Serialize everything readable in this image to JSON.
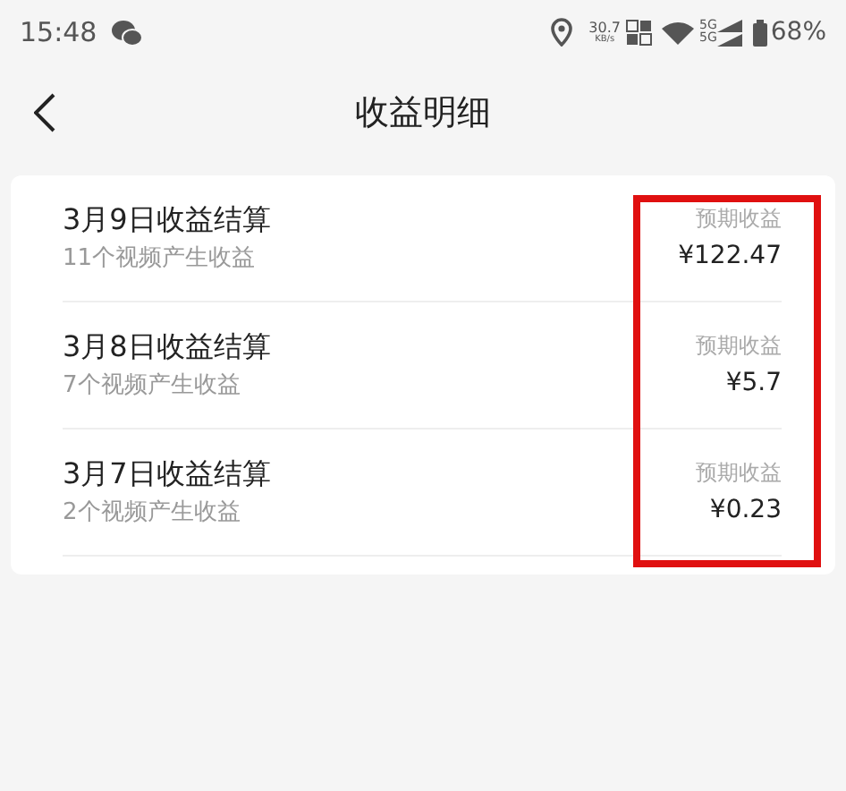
{
  "status_bar": {
    "time": "15:48",
    "net_speed": "30.7",
    "net_unit": "KB/s",
    "signal_labels": [
      "5G",
      "5G"
    ],
    "battery": "68%"
  },
  "header": {
    "title": "收益明细"
  },
  "records": [
    {
      "title": "3月9日收益结算",
      "subtitle": "11个视频产生收益",
      "label": "预期收益",
      "amount": "¥122.47"
    },
    {
      "title": "3月8日收益结算",
      "subtitle": "7个视频产生收益",
      "label": "预期收益",
      "amount": "¥5.7"
    },
    {
      "title": "3月7日收益结算",
      "subtitle": "2个视频产生收益",
      "label": "预期收益",
      "amount": "¥0.23"
    }
  ]
}
